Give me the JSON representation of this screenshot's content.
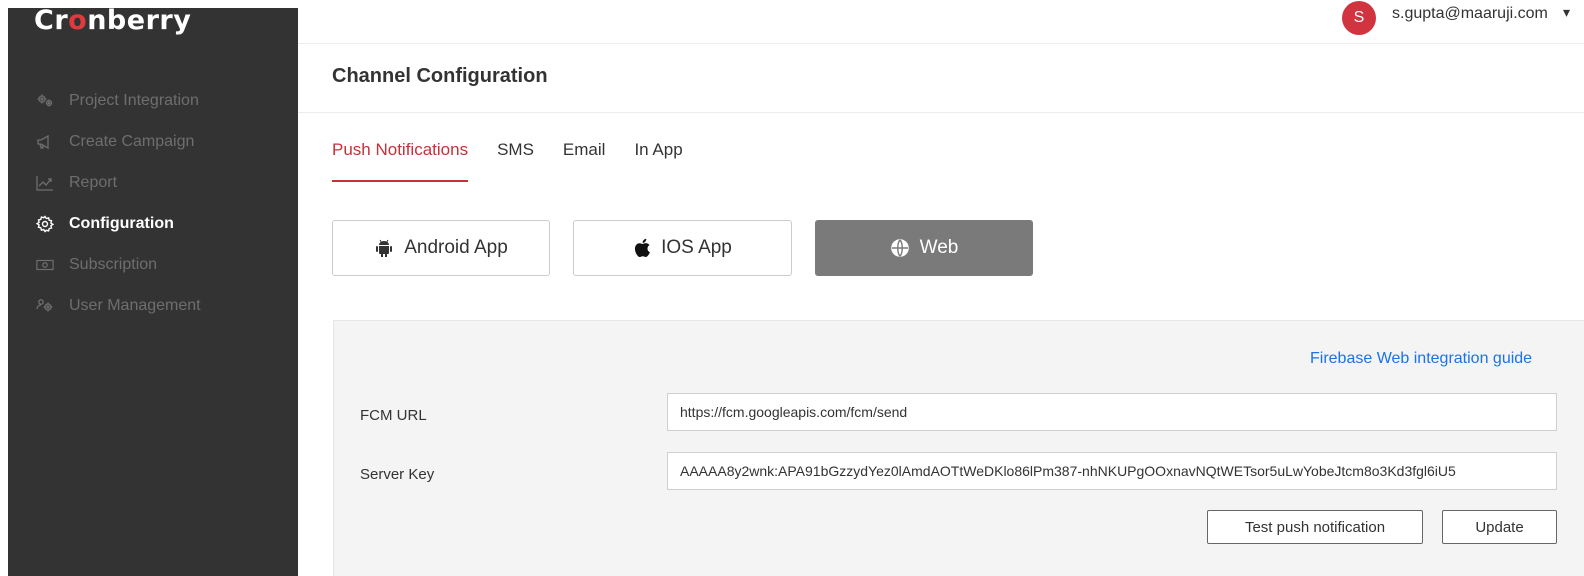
{
  "brand": {
    "logo_prefix": "Cr",
    "logo_accent": "o",
    "logo_suffix": "nberry"
  },
  "sidebar": {
    "items": [
      {
        "label": "Project Integration",
        "icon": "integration-icon",
        "active": false
      },
      {
        "label": "Create Campaign",
        "icon": "megaphone-icon",
        "active": false
      },
      {
        "label": "Report",
        "icon": "chart-line-icon",
        "active": false
      },
      {
        "label": "Configuration",
        "icon": "gear-icon",
        "active": true
      },
      {
        "label": "Subscription",
        "icon": "money-icon",
        "active": false
      },
      {
        "label": "User Management",
        "icon": "users-icon",
        "active": false
      }
    ]
  },
  "header": {
    "avatar_initial": "S",
    "user_email": "s.gupta@maaruji.com",
    "caret": "▾"
  },
  "page": {
    "title": "Channel Configuration"
  },
  "tabs": [
    {
      "label": "Push Notifications",
      "active": true
    },
    {
      "label": "SMS",
      "active": false
    },
    {
      "label": "Email",
      "active": false
    },
    {
      "label": "In App",
      "active": false
    }
  ],
  "platforms": [
    {
      "label": "Android App",
      "icon": "android-icon",
      "selected": false
    },
    {
      "label": "IOS App",
      "icon": "apple-icon",
      "selected": false
    },
    {
      "label": "Web",
      "icon": "globe-icon",
      "selected": true
    }
  ],
  "config": {
    "guide_link": "Firebase Web integration guide",
    "fcm_url_label": "FCM URL",
    "fcm_url_value": "https://fcm.googleapis.com/fcm/send",
    "server_key_label": "Server Key",
    "server_key_value": "AAAAA8y2wnk:APA91bGzzydYez0lAmdAOTtWeDKlo86lPm387-nhNKUPgOOxnavNQtWETsor5uLwYobeJtcm8o3Kd3fgl6iU5",
    "test_button": "Test push notification",
    "update_button": "Update"
  },
  "colors": {
    "sidebar_bg": "#333333",
    "accent": "#c8303a",
    "avatar": "#d1343f",
    "link": "#1a73e8",
    "selected_platform": "#7a7a7a",
    "panel_bg": "#f4f4f4"
  }
}
